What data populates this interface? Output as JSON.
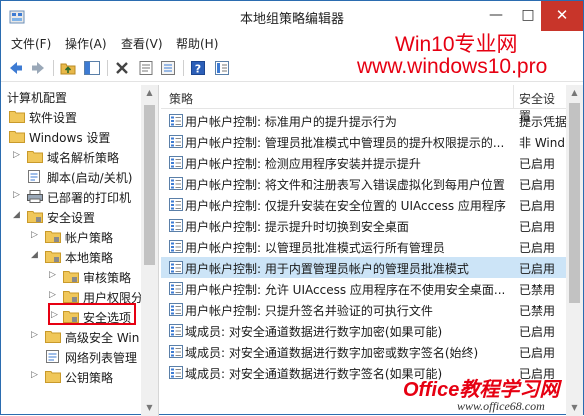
{
  "window": {
    "title": "本地组策略编辑器"
  },
  "menu": [
    {
      "label": "文件(F)"
    },
    {
      "label": "操作(A)"
    },
    {
      "label": "查看(V)"
    },
    {
      "label": "帮助(H)"
    }
  ],
  "watermark": {
    "line1": "Win10专业网",
    "line2": "www.windows10.pro"
  },
  "tree": {
    "items": [
      {
        "label": "计算机配置"
      },
      {
        "label": "软件设置"
      },
      {
        "label": "Windows 设置"
      },
      {
        "label": "域名解析策略"
      },
      {
        "label": "脚本(启动/关机)"
      },
      {
        "label": "已部署的打印机"
      },
      {
        "label": "安全设置"
      },
      {
        "label": "帐户策略"
      },
      {
        "label": "本地策略"
      },
      {
        "label": "审核策略"
      },
      {
        "label": "用户权限分"
      },
      {
        "label": "安全选项"
      },
      {
        "label": "高级安全 Win"
      },
      {
        "label": "网络列表管理"
      },
      {
        "label": "公钥策略"
      }
    ]
  },
  "list": {
    "columns": {
      "policy": "策略",
      "setting": "安全设置"
    },
    "rows": [
      {
        "policy": "用户帐户控制: 标准用户的提升提示行为",
        "setting": "提示凭据"
      },
      {
        "policy": "用户帐户控制: 管理员批准模式中管理员的提升权限提示的...",
        "setting": "非 Wind"
      },
      {
        "policy": "用户帐户控制: 检测应用程序安装并提示提升",
        "setting": "已启用"
      },
      {
        "policy": "用户帐户控制: 将文件和注册表写入错误虚拟化到每用户位置",
        "setting": "已启用"
      },
      {
        "policy": "用户帐户控制: 仅提升安装在安全位置的 UIAccess 应用程序",
        "setting": "已启用"
      },
      {
        "policy": "用户帐户控制: 提示提升时切换到安全桌面",
        "setting": "已启用"
      },
      {
        "policy": "用户帐户控制: 以管理员批准模式运行所有管理员",
        "setting": "已启用"
      },
      {
        "policy": "用户帐户控制: 用于内置管理员帐户的管理员批准模式",
        "setting": "已启用"
      },
      {
        "policy": "用户帐户控制: 允许 UIAccess 应用程序在不使用安全桌面...",
        "setting": "已禁用"
      },
      {
        "policy": "用户帐户控制: 只提升签名并验证的可执行文件",
        "setting": "已禁用"
      },
      {
        "policy": "域成员: 对安全通道数据进行数字加密(如果可能)",
        "setting": "已启用"
      },
      {
        "policy": "域成员: 对安全通道数据进行数字加密或数字签名(始终)",
        "setting": "已启用"
      },
      {
        "policy": "域成员: 对安全通道数据进行数字签名(如果可能)",
        "setting": "已启用"
      }
    ],
    "selected_index": 7
  },
  "logo": {
    "main": "Office教程学习网",
    "url": "www.office68.com"
  },
  "colors": {
    "accent": "#e60012",
    "selection": "#cce4f7",
    "close": "#c8352a"
  }
}
